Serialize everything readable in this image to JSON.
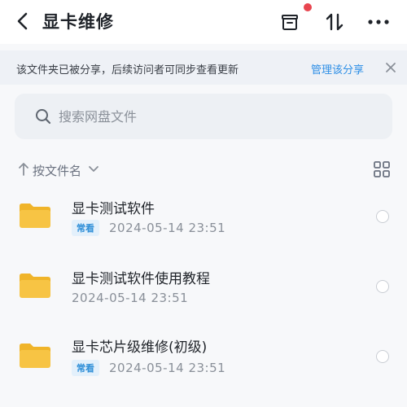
{
  "header": {
    "title": "显卡维修",
    "icons": [
      "back-icon",
      "box-icon",
      "sort-icon",
      "more-icon"
    ]
  },
  "share_notice": {
    "text": "该文件夹已被分享，后续访问者可同步查看更新",
    "link": "管理该分享"
  },
  "search": {
    "placeholder": "搜索网盘文件"
  },
  "sort": {
    "label": "按文件名"
  },
  "files": [
    {
      "name": "显卡测试软件",
      "badge": "常看",
      "date": "2024-05-14  23:51"
    },
    {
      "name": "显卡测试软件使用教程",
      "badge": "",
      "date": "2024-05-14  23:51"
    },
    {
      "name": "显卡芯片级维修(初级)",
      "badge": "常看",
      "date": "2024-05-14  23:51"
    }
  ],
  "colors": {
    "accent": "#2e8fe6",
    "folder": "#f7c444",
    "badge_bg": "#e3f0fb",
    "notification_dot": "#e8454f"
  }
}
